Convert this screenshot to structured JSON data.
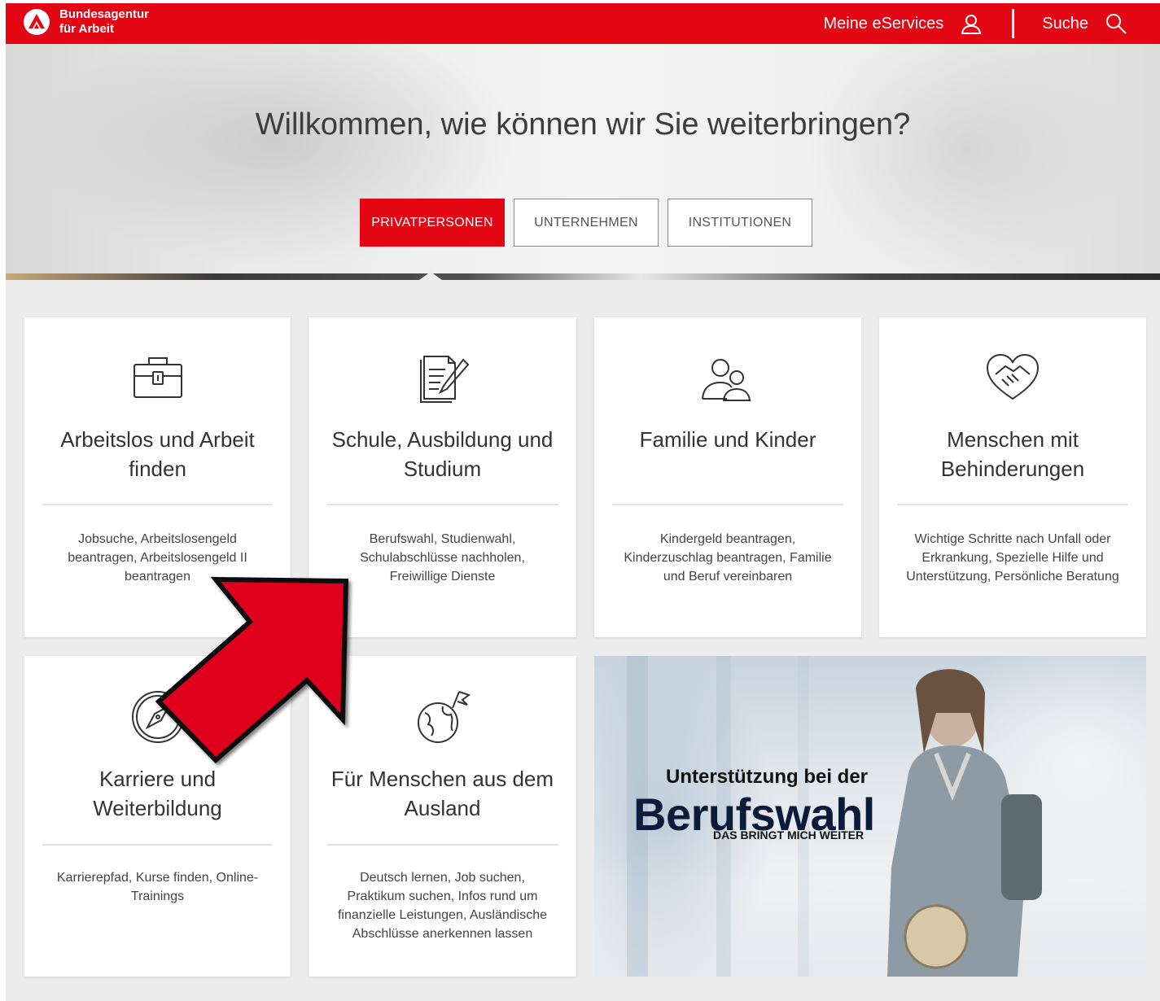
{
  "header": {
    "logo_line1": "Bundesagentur",
    "logo_line2": "für Arbeit",
    "eservices_label": "Meine eServices",
    "search_label": "Suche",
    "brand_color": "#e30613"
  },
  "hero": {
    "title": "Willkommen, wie können wir Sie weiterbringen?",
    "tabs": [
      {
        "label": "PRIVATPERSONEN",
        "active": true
      },
      {
        "label": "UNTERNEHMEN",
        "active": false
      },
      {
        "label": "INSTITUTIONEN",
        "active": false
      }
    ]
  },
  "cards": [
    {
      "icon": "briefcase-icon",
      "title_line1": "Arbeitslos und Arbeit",
      "title_line2": "finden",
      "desc": [
        "Jobsuche, Arbeitslosengeld",
        "beantragen, Arbeitslosengeld II",
        "beantragen"
      ]
    },
    {
      "icon": "document-pen-icon",
      "title_line1": "Schule, Ausbildung und",
      "title_line2": "Studium",
      "desc": [
        "Berufswahl, Studienwahl,",
        "Schulabschlüsse nachholen,",
        "Freiwillige Dienste"
      ]
    },
    {
      "icon": "family-icon",
      "title_line1": "Familie und Kinder",
      "title_line2": "",
      "desc": [
        "Kindergeld beantragen,",
        "Kinderzuschlag beantragen, Familie",
        "und Beruf vereinbaren"
      ]
    },
    {
      "icon": "heart-handshake-icon",
      "title_line1": "Menschen mit",
      "title_line2": "Behinderungen",
      "desc": [
        "Wichtige Schritte nach Unfall oder",
        "Erkrankung, Spezielle Hilfe und",
        "Unterstützung, Persönliche Beratung"
      ]
    },
    {
      "icon": "compass-icon",
      "title_line1": "Karriere und",
      "title_line2": "Weiterbildung",
      "desc": [
        "Karrierepfad, Kurse finden, Online-",
        "Trainings"
      ]
    },
    {
      "icon": "globe-flag-icon",
      "title_line1": "Für Menschen aus dem",
      "title_line2": "Ausland",
      "desc": [
        "Deutsch lernen, Job suchen,",
        "Praktikum suchen, Infos rund um",
        "finanzielle Leistungen, Ausländische",
        "Abschlüsse anerkennen lassen"
      ]
    }
  ],
  "promo": {
    "subtitle": "Unterstützung bei der",
    "headline": "Berufswahl",
    "tagline": "DAS BRINGT MICH WEITER"
  },
  "overlay": {
    "arrow_icon": "red-arrow-icon",
    "arrow_color": "#e0001b"
  }
}
